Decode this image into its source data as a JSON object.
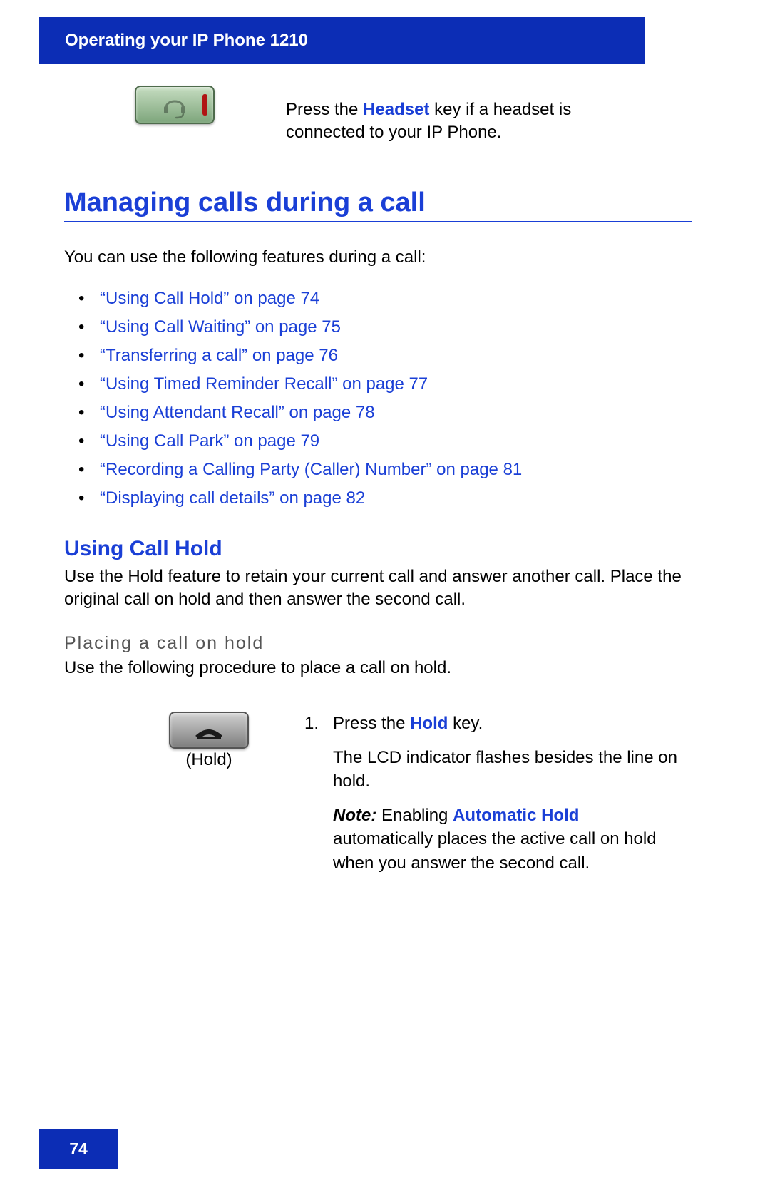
{
  "header": {
    "title": "Operating your IP Phone 1210"
  },
  "headset": {
    "text_prefix": "Press the ",
    "key_name": "Headset",
    "text_suffix": " key if a headset is connected to your IP Phone."
  },
  "section": {
    "title": "Managing calls during a call",
    "intro": "You can use the following features during a call:",
    "features": [
      "“Using Call Hold” on page 74",
      "“Using Call Waiting” on page 75",
      "“Transferring a call” on page 76",
      "“Using Timed Reminder Recall” on page 77",
      "“Using Attendant Recall” on page 78",
      "“Using Call Park” on page 79",
      "“Recording a Calling Party (Caller) Number” on page 81",
      "“Displaying call details” on page 82"
    ]
  },
  "call_hold": {
    "title": "Using Call Hold",
    "body": "Use the Hold feature to retain your current call and answer another call. Place the original call on hold and then answer the second call.",
    "procedure_title": "Placing a call on hold",
    "procedure_intro": "Use the following procedure to place a call on hold.",
    "icon_label": "(Hold)",
    "step_number": "1.",
    "step_prefix": "Press the ",
    "step_key": "Hold",
    "step_suffix": " key.",
    "step_result": "The LCD indicator flashes besides the line on hold.",
    "note_label": "Note:",
    "note_prefix": " Enabling ",
    "note_key": "Automatic Hold",
    "note_suffix": " automatically places the active call on hold when you answer the second call."
  },
  "footer": {
    "page_number": "74"
  }
}
